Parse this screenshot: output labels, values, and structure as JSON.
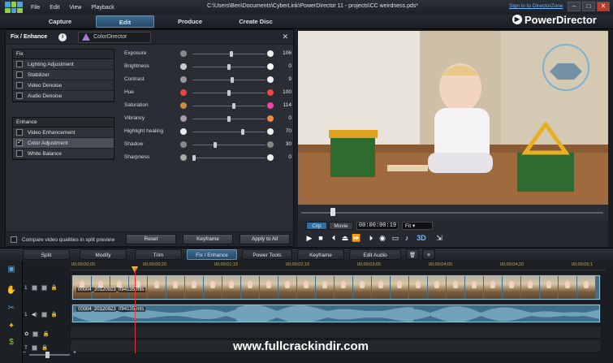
{
  "titlebar": {
    "menu": [
      "File",
      "Edit",
      "View",
      "Playback"
    ],
    "path": "C:\\Users\\Ben\\Documents\\CyberLink\\PowerDirector 11 - projects\\CC weirdness.pds*"
  },
  "modes": {
    "capture": "Capture",
    "edit": "Edit",
    "produce": "Produce",
    "create_disc": "Create Disc"
  },
  "signin": "Sign in to DirectorZone",
  "brand": "PowerDirector",
  "panel": {
    "title": "Fix / Enhance",
    "colordirector": "ColorDirector",
    "fix": {
      "header": "Fix",
      "items": [
        "Lighting Adjustment",
        "Stabilizer",
        "Video Denoise",
        "Audio Denoise"
      ]
    },
    "enhance": {
      "header": "Enhance",
      "items": [
        "Video Enhancement",
        "Color Adjustment",
        "White Balance"
      ],
      "checked_index": 1
    },
    "adjustments": [
      {
        "label": "Exposure",
        "value": "106",
        "level": 0.53
      },
      {
        "label": "Brightness",
        "value": "0",
        "level": 0.5
      },
      {
        "label": "Contrast",
        "value": "9",
        "level": 0.55
      },
      {
        "label": "Hue",
        "value": "100",
        "level": 0.5
      },
      {
        "label": "Saturation",
        "value": "114",
        "level": 0.57
      },
      {
        "label": "Vibrancy",
        "value": "0",
        "level": 0.5
      },
      {
        "label": "Highlight healing",
        "value": "70",
        "level": 0.7
      },
      {
        "label": "Shadow",
        "value": "30",
        "level": 0.3
      },
      {
        "label": "Sharpness",
        "value": "0",
        "level": 0.0
      }
    ],
    "compare_label": "Compare video qualities in split preview",
    "reset": "Reset",
    "keyframe": "Keyframe",
    "apply_all": "Apply to All"
  },
  "preview": {
    "clip_tab": "Clip",
    "movie_tab": "Movie",
    "timecode": "00:00:00:19",
    "fit": "Fit"
  },
  "toolbar": {
    "split": "Split",
    "modify": "Modify",
    "trim": "Trim",
    "fix_enhance": "Fix / Enhance",
    "power_tools": "Power Tools",
    "keyframe": "Keyframe",
    "edit_audio": "Edit Audio"
  },
  "timeline": {
    "ruler": [
      "00;00;00;00",
      "00;00;00;20",
      "00;00;01;15",
      "00;00;02;10",
      "00;00;03;05",
      "00;00;04;00",
      "00;00;04;20",
      "00;00;05;1"
    ],
    "track1": "1",
    "video_clip": "00004_20120923_094135.mts",
    "audio_clip": "00004_20120923_094135.mts"
  },
  "watermark": "www.fullcrackindir.com"
}
